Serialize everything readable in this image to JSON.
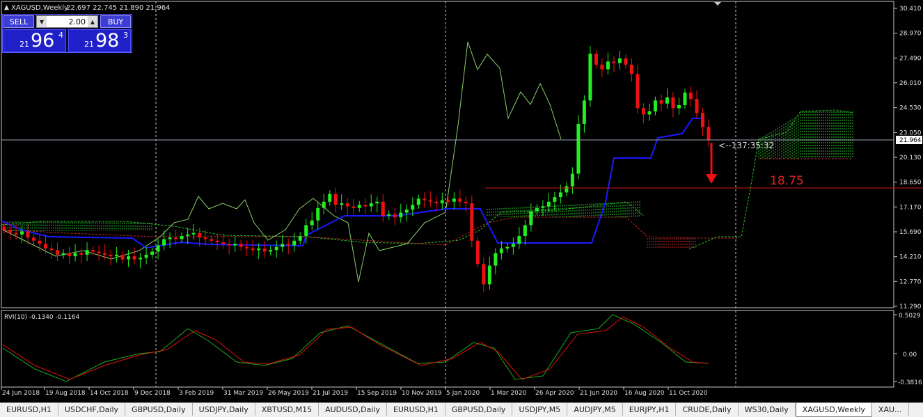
{
  "header": {
    "symbol_info": "XAGUSD,Weekly",
    "ohlc": "22.697 22.745 21.890 21.964"
  },
  "trade_panel": {
    "sell_label": "SELL",
    "buy_label": "BUY",
    "lot_value": "2.00",
    "bid": {
      "small": "21",
      "big": "96",
      "sup": "4"
    },
    "ask": {
      "small": "21",
      "big": "98",
      "sup": "3"
    }
  },
  "price_axis": {
    "labels": [
      "30.410",
      "28.970",
      "27.490",
      "26.010",
      "24.530",
      "23.050",
      "21.964",
      "20.130",
      "18.650",
      "17.170",
      "15.690",
      "14.210",
      "12.770",
      "11.290"
    ]
  },
  "time_axis": {
    "labels": [
      "24 Jun 2018",
      "19 Aug 2018",
      "14 Oct 2018",
      "9 Dec 2018",
      "3 Feb 2019",
      "31 Mar 2019",
      "26 May 2019",
      "21 Jul 2019",
      "15 Sep 2019",
      "10 Nov 2019",
      "5 Jan 2020",
      "1 Mar 2020",
      "26 Apr 2020",
      "21 Jun 2020",
      "16 Aug 2020",
      "11 Oct 2020"
    ]
  },
  "annotations": {
    "countdown": "<--137:35:32",
    "target_level": "18.75"
  },
  "indicator": {
    "label": "RVI(10) -0.1340 -0.1164",
    "axis_labels": [
      "0.5029",
      "0.00",
      "-0.3816"
    ]
  },
  "tabs": [
    "EURUSD,H1",
    "USDCHF,Daily",
    "GBPUSD,Daily",
    "USDJPY,Daily",
    "XBTUSD,M15",
    "AUDUSD,Daily",
    "EURUSD,H1",
    "GBPUSD,Daily",
    "USDJPY,M5",
    "AUDJPY,M5",
    "EURJPY,H1",
    "CRUDE,Daily",
    "WS30,Daily",
    "XAGUSD,Weekly",
    "XAU..."
  ],
  "active_tab": 13,
  "colors": {
    "up_candle": "#22ee22",
    "down_candle": "#ee1111",
    "kijun": "#1a1aff",
    "chikou": "#8ad16a",
    "target_line": "#d01818",
    "rvi_main": "#1ea81e",
    "rvi_signal": "#e01010"
  },
  "chart_data": {
    "type": "candlestick",
    "timeframe": "Weekly",
    "current_price": 21.964,
    "ylim": [
      11.29,
      30.41
    ],
    "target": 18.75,
    "closes": [
      16.2,
      16.0,
      15.9,
      16.1,
      15.7,
      15.5,
      15.3,
      15.0,
      14.9,
      14.6,
      14.7,
      14.5,
      14.7,
      14.6,
      14.9,
      14.8,
      14.7,
      14.6,
      14.5,
      14.6,
      14.3,
      14.5,
      14.3,
      14.4,
      14.6,
      14.8,
      15.2,
      15.6,
      15.7,
      15.6,
      15.8,
      15.9,
      16.0,
      15.7,
      15.6,
      15.5,
      15.4,
      15.3,
      15.2,
      15.3,
      15.1,
      15.0,
      14.9,
      15.0,
      14.8,
      14.9,
      15.1,
      15.3,
      15.2,
      15.5,
      15.8,
      16.5,
      16.8,
      17.6,
      18.0,
      18.5,
      17.8,
      17.9,
      17.7,
      17.6,
      17.8,
      17.7,
      17.9,
      18.0,
      17.1,
      17.2,
      17.0,
      17.3,
      17.5,
      17.8,
      18.2,
      18.1,
      18.0,
      17.9,
      18.1,
      18.0,
      18.2,
      18.0,
      17.9,
      15.5,
      14.0,
      12.7,
      13.9,
      14.7,
      15.0,
      15.1,
      15.3,
      15.8,
      16.5,
      17.4,
      17.6,
      17.7,
      18.0,
      18.3,
      18.6,
      19.0,
      19.8,
      23.0,
      24.5,
      27.5,
      26.8,
      26.5,
      27.0,
      26.9,
      27.2,
      26.8,
      26.2,
      24.0,
      23.6,
      23.8,
      24.5,
      24.3,
      24.7,
      24.0,
      24.2,
      25.0,
      24.6,
      23.7,
      22.8,
      21.964
    ]
  }
}
